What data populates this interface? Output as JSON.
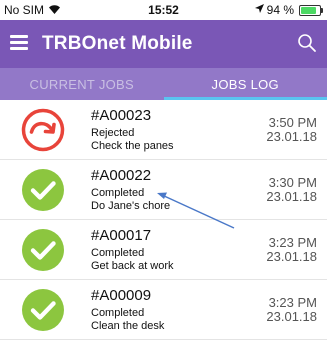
{
  "status_bar": {
    "carrier": "No SIM",
    "time": "15:52",
    "battery": "94 %",
    "battery_level": 0.94
  },
  "app_bar": {
    "title": "TRBOnet Mobile",
    "menu_icon": "hamburger-menu-icon",
    "search_icon": "search-icon"
  },
  "tabs": [
    {
      "label": "CURRENT JOBS",
      "active": false
    },
    {
      "label": "JOBS LOG",
      "active": true
    }
  ],
  "jobs": [
    {
      "id": "#A00023",
      "status": "Rejected",
      "description": "Check the panes",
      "time": "3:50 PM",
      "date": "23.01.18",
      "icon": "rejected-redo-icon"
    },
    {
      "id": "#A00022",
      "status": "Completed",
      "description": "Do Jane's chore",
      "time": "3:30 PM",
      "date": "23.01.18",
      "icon": "completed-check-icon"
    },
    {
      "id": "#A00017",
      "status": "Completed",
      "description": "Get back at work",
      "time": "3:23 PM",
      "date": "23.01.18",
      "icon": "completed-check-icon"
    },
    {
      "id": "#A00009",
      "status": "Completed",
      "description": "Clean the desk",
      "time": "3:23 PM",
      "date": "23.01.18",
      "icon": "completed-check-icon"
    }
  ],
  "colors": {
    "app_bar": "#7a57b6",
    "tab_bar": "#9278c8",
    "tab_indicator": "#5ac4f0",
    "completed": "#8cc63f",
    "rejected": "#e8443a",
    "annotation_arrow": "#4a78c8"
  }
}
